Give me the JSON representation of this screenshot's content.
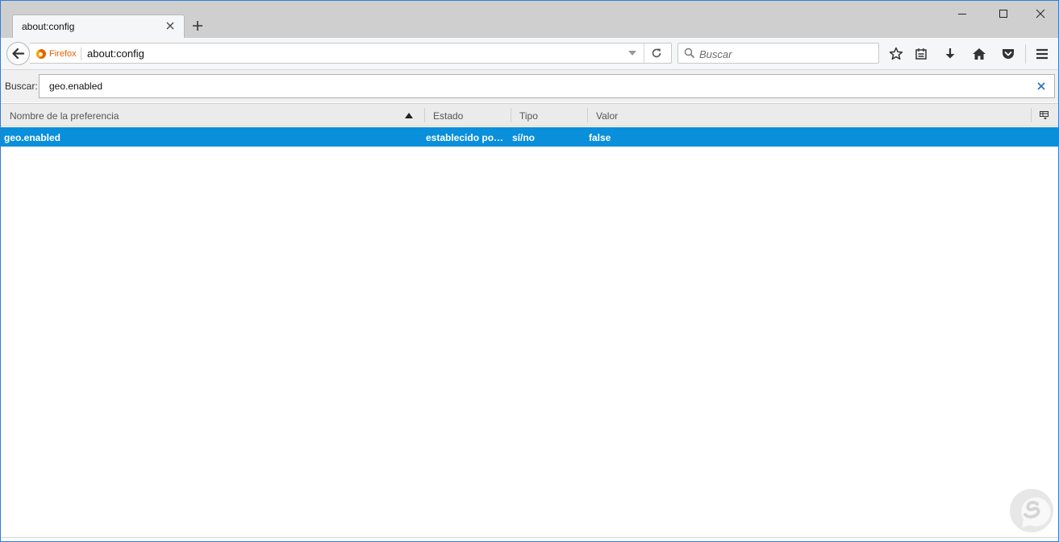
{
  "tabs": [
    {
      "title": "about:config"
    }
  ],
  "navbar": {
    "identity_label": "Firefox",
    "url": "about:config",
    "search_placeholder": "Buscar",
    "icons": [
      "back-icon",
      "dropdown-icon",
      "reload-icon",
      "search-icon",
      "bookmark-star-icon",
      "reading-list-icon",
      "download-icon",
      "home-icon",
      "pocket-icon",
      "menu-icon"
    ]
  },
  "window_controls": [
    "minimize-icon",
    "maximize-icon",
    "close-icon"
  ],
  "filter": {
    "label": "Buscar:",
    "value": "geo.enabled"
  },
  "table": {
    "columns": [
      "Nombre de la preferencia",
      "Estado",
      "Tipo",
      "Valor"
    ],
    "sort_column": "Nombre de la preferencia",
    "sort_direction": "ascending",
    "rows": [
      {
        "name": "geo.enabled",
        "status": "establecido por ...",
        "type": "sí/no",
        "value": "false",
        "selected": true
      }
    ]
  },
  "colors": {
    "selection": "#0a8fdb",
    "tabstrip": "#cfcfcf",
    "toolbar": "#f5f6f7",
    "firefox_orange": "#e66000",
    "window_border": "#2b7fd4"
  }
}
